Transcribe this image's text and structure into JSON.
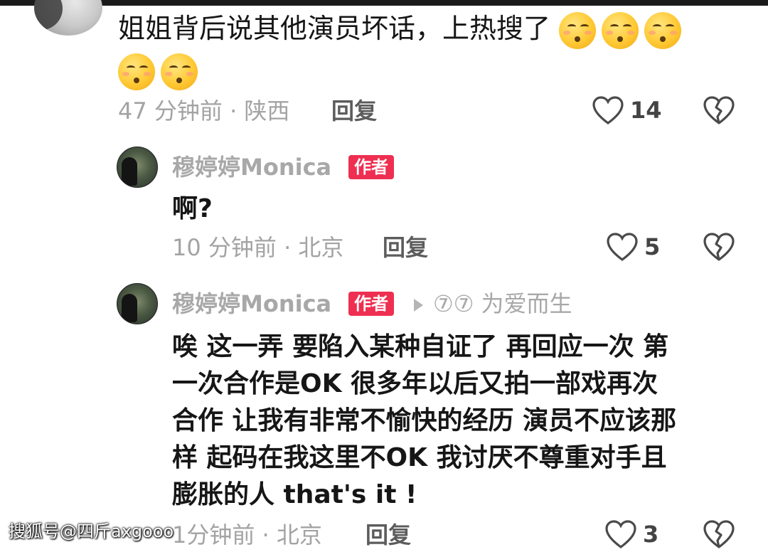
{
  "comment": {
    "text": "姐姐背后说其他演员坏话，上热搜了",
    "emoji_icons": [
      "shushing-face-icon",
      "shushing-face-icon",
      "shushing-face-icon",
      "shushing-face-icon",
      "shushing-face-icon"
    ],
    "time_location": "47 分钟前 · 陕西",
    "reply_label": "回复",
    "like_count": "14"
  },
  "replies": [
    {
      "username": "穆婷婷Monica",
      "badge": "作者",
      "text": "啊?",
      "time_location": "10 分钟前 · 北京",
      "reply_label": "回复",
      "like_count": "5"
    },
    {
      "username": "穆婷婷Monica",
      "badge": "作者",
      "reply_to": "⑦⑦ 为爱而生",
      "text_lines": [
        "唉 这一弄 要陷入某种自证了 再回应一次 第",
        "一次合作是OK 很多年以后又拍一部戏再次",
        "合作 让我有非常不愉快的经历 演员不应该那",
        "样 起码在我这里不OK 我讨厌不尊重对手且",
        "膨胀的人 that's it !"
      ],
      "time_location": "1分钟前 · 北京",
      "reply_label": "回复",
      "like_count": "3"
    }
  ],
  "watermark": "搜狐号@四斤axgooo",
  "colors": {
    "author_badge": "#ee2f51",
    "meta_gray": "#a3a3a3",
    "text": "#161616"
  }
}
